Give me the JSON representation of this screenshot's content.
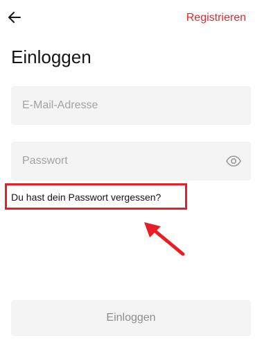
{
  "header": {
    "back_icon": "arrow-left-icon",
    "register_label": "Registrieren"
  },
  "title": "Einloggen",
  "form": {
    "email": {
      "value": "",
      "placeholder": "E-Mail-Adresse"
    },
    "password": {
      "value": "",
      "placeholder": "Passwort",
      "toggle_icon": "eye-icon"
    },
    "forgot_label": "Du hast dein Passwort vergessen?",
    "submit_label": "Einloggen"
  },
  "colors": {
    "accent": "#e8252a",
    "annotation": "#ea1c24",
    "field_bg": "#f4f4f4",
    "placeholder": "#a2a2a2",
    "disabled_text": "#8d8d8d"
  }
}
